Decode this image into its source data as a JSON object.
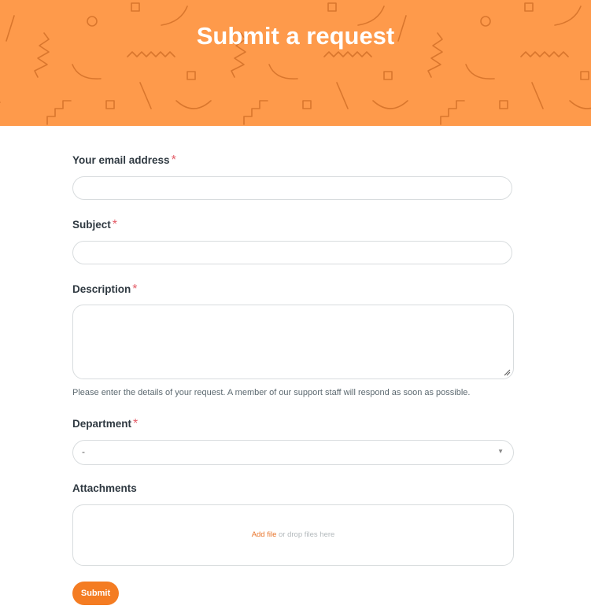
{
  "header": {
    "title": "Submit a request",
    "background_color": "#fe9a4b"
  },
  "form": {
    "email": {
      "label": "Your email address",
      "required_mark": "*",
      "value": ""
    },
    "subject": {
      "label": "Subject",
      "required_mark": "*",
      "value": ""
    },
    "description": {
      "label": "Description",
      "required_mark": "*",
      "value": "",
      "hint": "Please enter the details of your request. A member of our support staff will respond as soon as possible."
    },
    "department": {
      "label": "Department",
      "required_mark": "*",
      "selected": "-"
    },
    "attachments": {
      "label": "Attachments",
      "add_file": "Add file",
      "drop_text": " or drop files here"
    },
    "submit_label": "Submit"
  },
  "colors": {
    "accent": "#f47c22",
    "required": "#e35b66",
    "border": "#d8dcde"
  }
}
